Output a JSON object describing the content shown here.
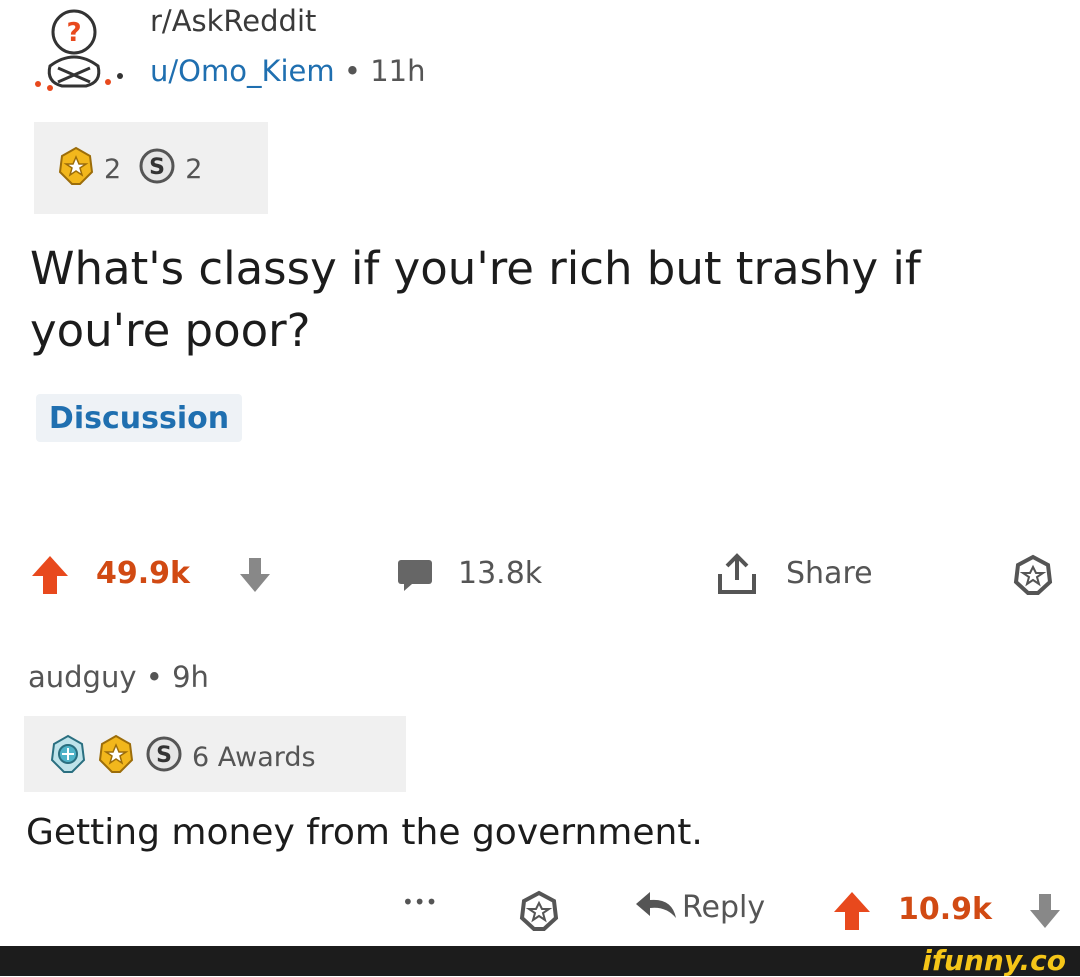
{
  "post": {
    "subreddit": "r/AskReddit",
    "author": "u/Omo_Kiem",
    "time_sep": " • ",
    "time": "11h",
    "awards": [
      {
        "icon": "gold-award-icon",
        "count": "2"
      },
      {
        "icon": "silver-award-icon",
        "count": "2"
      }
    ],
    "title": "What's classy if you're rich but trashy if you're poor?",
    "flair": "Discussion",
    "upvotes": "49.9k",
    "comments": "13.8k",
    "share_label": "Share"
  },
  "comment": {
    "author": "audguy",
    "time_sep": " • ",
    "time": "9h",
    "awards_label": "6 Awards",
    "body": "Getting money from the government.",
    "more_label": "•••",
    "reply_label": "Reply",
    "upvotes": "10.9k"
  },
  "watermark": {
    "text": "ifunny.co"
  },
  "colors": {
    "upvote": "#e8491d",
    "link_blue": "#1f6fb0",
    "award_gold": "#f2b71c"
  }
}
